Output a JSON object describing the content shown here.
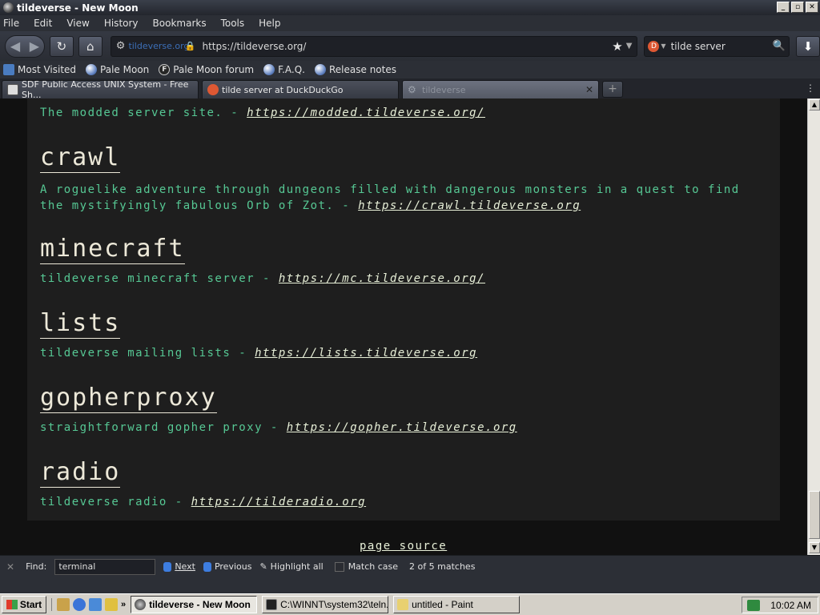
{
  "window": {
    "title": "tildeverse - New Moon"
  },
  "menu": [
    "File",
    "Edit",
    "View",
    "History",
    "Bookmarks",
    "Tools",
    "Help"
  ],
  "nav": {
    "identity": "tildeverse.org",
    "url": "https://tildeverse.org/",
    "search": "tilde server"
  },
  "bookmarks": [
    "Most Visited",
    "Pale Moon",
    "Pale Moon forum",
    "F.A.Q.",
    "Release notes"
  ],
  "tabs": [
    {
      "label": "SDF Public Access UNIX System - Free Sh..."
    },
    {
      "label": "tilde server at DuckDuckGo"
    },
    {
      "label": "tildeverse"
    }
  ],
  "page": {
    "modded_desc": "The modded server site. - ",
    "modded_link": "https://modded.tildeverse.org/",
    "sections": [
      {
        "title": "crawl",
        "desc": "A roguelike adventure through dungeons filled with dangerous monsters in a quest to find\nthe mystifyingly fabulous Orb of Zot. - ",
        "link": "https://crawl.tildeverse.org"
      },
      {
        "title": "minecraft",
        "desc": "tildeverse minecraft server - ",
        "link": "https://mc.tildeverse.org/"
      },
      {
        "title": "lists",
        "desc": "tildeverse mailing lists - ",
        "link": "https://lists.tildeverse.org"
      },
      {
        "title": "gopherproxy",
        "desc": "straightforward gopher proxy - ",
        "link": "https://gopher.tildeverse.org"
      },
      {
        "title": "radio",
        "desc": "tildeverse radio - ",
        "link": "https://tilderadio.org"
      }
    ],
    "page_source": "page source"
  },
  "find": {
    "label": "Find:",
    "value": "terminal",
    "next": "Next",
    "previous": "Previous",
    "highlight": "Highlight all",
    "match_case": "Match case",
    "status": "2 of 5 matches"
  },
  "taskbar": {
    "start": "Start",
    "tasks": [
      "tildeverse - New Moon",
      "C:\\WINNT\\system32\\teln...",
      "untitled - Paint"
    ],
    "clock": "10:02 AM"
  }
}
